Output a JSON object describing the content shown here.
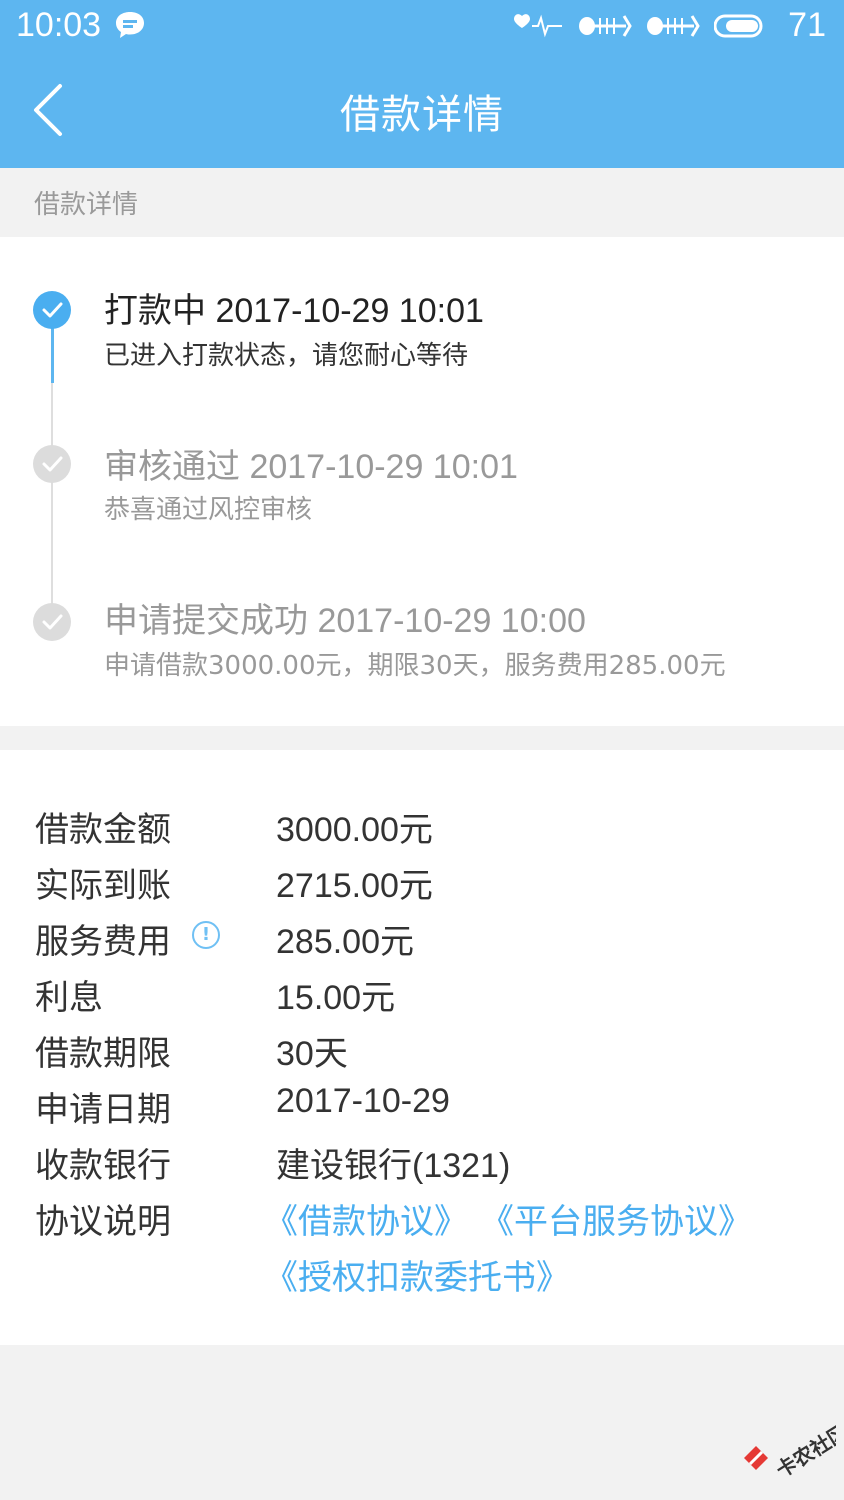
{
  "status_bar": {
    "time": "10:03",
    "battery_level": "71"
  },
  "header": {
    "title": "借款详情"
  },
  "section_label": "借款详情",
  "timeline": [
    {
      "title": "打款中 2017-10-29 10:01",
      "desc": "已进入打款状态，请您耐心等待",
      "state": "active"
    },
    {
      "title": "审核通过 2017-10-29 10:01",
      "desc": "恭喜通过风控审核",
      "state": "done"
    },
    {
      "title": "申请提交成功 2017-10-29 10:00",
      "desc": "申请借款3000.00元，期限30天，服务费用285.00元",
      "state": "done"
    }
  ],
  "details": {
    "amount_label": "借款金额",
    "amount_value": "3000.00元",
    "received_label": "实际到账",
    "received_value": "2715.00元",
    "fee_label": "服务费用",
    "fee_value": "285.00元",
    "interest_label": "利息",
    "interest_value": "15.00元",
    "term_label": "借款期限",
    "term_value": "30天",
    "date_label": "申请日期",
    "date_value": "2017-10-29",
    "bank_label": "收款银行",
    "bank_value": "建设银行(1321)",
    "agreement_label": "协议说明",
    "agreements": [
      "《借款协议》",
      "《平台服务协议》",
      "《授权扣款委托书》"
    ]
  },
  "colors": {
    "primary": "#5db6f0",
    "link": "#4aaef0",
    "muted": "#9a9a9a",
    "background": "#f2f2f2"
  },
  "watermark_text": "卡农社区"
}
